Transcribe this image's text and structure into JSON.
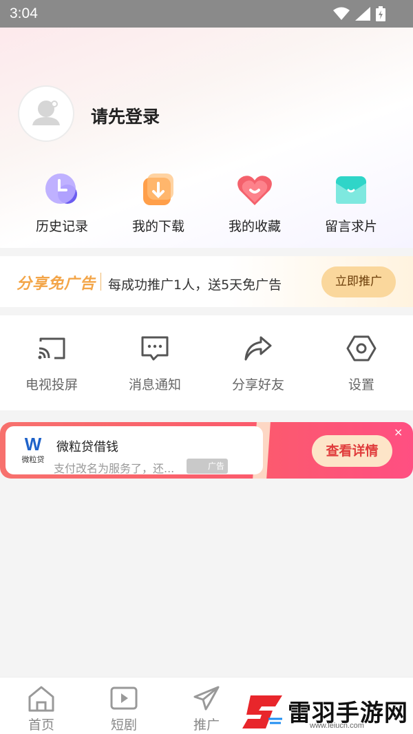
{
  "status_bar": {
    "time": "3:04"
  },
  "profile": {
    "login_prompt": "请先登录"
  },
  "quick_actions": [
    {
      "label": "历史记录",
      "icon": "history-clock-icon",
      "color": "#8f7cf7"
    },
    {
      "label": "我的下载",
      "icon": "download-icon",
      "color": "#ff9f4a"
    },
    {
      "label": "我的收藏",
      "icon": "favorite-heart-icon",
      "color": "#f4616c"
    },
    {
      "label": "留言求片",
      "icon": "message-envelope-icon",
      "color": "#2fd5c8"
    }
  ],
  "promo": {
    "brand": "分享免广告",
    "description": "每成功推广1人，送5天免广告",
    "button": "立即推广"
  },
  "tools": [
    {
      "label": "电视投屏",
      "icon": "cast-screen-icon"
    },
    {
      "label": "消息通知",
      "icon": "message-bubble-icon"
    },
    {
      "label": "分享好友",
      "icon": "share-arrow-icon"
    },
    {
      "label": "设置",
      "icon": "settings-hexagon-icon"
    }
  ],
  "ad": {
    "logo_text": "微粒贷",
    "title": "微粒贷借钱",
    "subtitle": "支付改名为服务了，还...",
    "tag": "广告",
    "cta": "查看详情",
    "close": "×"
  },
  "tab_bar": [
    {
      "label": "首页",
      "icon": "home-icon"
    },
    {
      "label": "短剧",
      "icon": "play-video-icon"
    },
    {
      "label": "推广",
      "icon": "paper-plane-icon"
    }
  ],
  "watermark": {
    "text": "雷羽手游网",
    "url": "www.leiucn.com"
  }
}
